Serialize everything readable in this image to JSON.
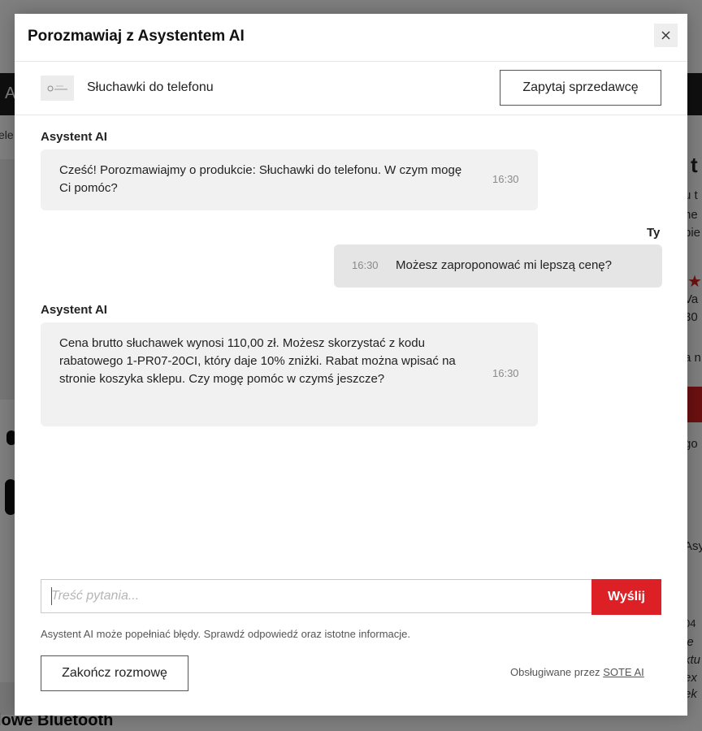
{
  "background": {
    "nav_letter": "A",
    "breadcrumb": "ele",
    "right_fragments": [
      "u t",
      "ne",
      "pie",
      "Va",
      "30",
      "a n",
      "go",
      "Asy",
      "04",
      "ie",
      "ktu",
      "ex",
      "ek"
    ],
    "right_title": "t",
    "bottom_title": "lowe Bluetooth"
  },
  "modal": {
    "title": "Porozmawiaj z Asystentem AI",
    "close_label": "×"
  },
  "product": {
    "name": "Słuchawki do telefonu",
    "ask_seller_label": "Zapytaj sprzedawcę"
  },
  "messages": [
    {
      "sender": "Asystent AI",
      "text": "Cześć! Porozmawiajmy o produkcie: Słuchawki do telefonu. W czym mogę Ci pomóc?",
      "time": "16:30"
    },
    {
      "sender": "Ty",
      "text": "Możesz zaproponować mi lepszą cenę?",
      "time": "16:30"
    },
    {
      "sender": "Asystent AI",
      "text": "Cena brutto słuchawek wynosi 110,00 zł. Możesz skorzystać z kodu rabatowego 1-PR07-20CI, który daje 10% zniżki. Rabat można wpisać na stronie koszyka sklepu. Czy mogę pomóc w czymś jeszcze?",
      "time": "16:30"
    }
  ],
  "input": {
    "placeholder": "Treść pytania...",
    "value": "",
    "send_label": "Wyślij"
  },
  "disclaimer": "Asystent AI może popełniać błędy. Sprawdź odpowiedź oraz istotne informacje.",
  "footer": {
    "end_label": "Zakończ rozmowę",
    "powered_text": "Obsługiwane przez",
    "powered_link": "SOTE AI"
  },
  "colors": {
    "accent": "#dd1f26",
    "bubble_bot": "#f1f1f1",
    "bubble_user": "#e5e5e5"
  },
  "icons": {
    "close": "close-icon",
    "product": "product-thumbnail"
  }
}
